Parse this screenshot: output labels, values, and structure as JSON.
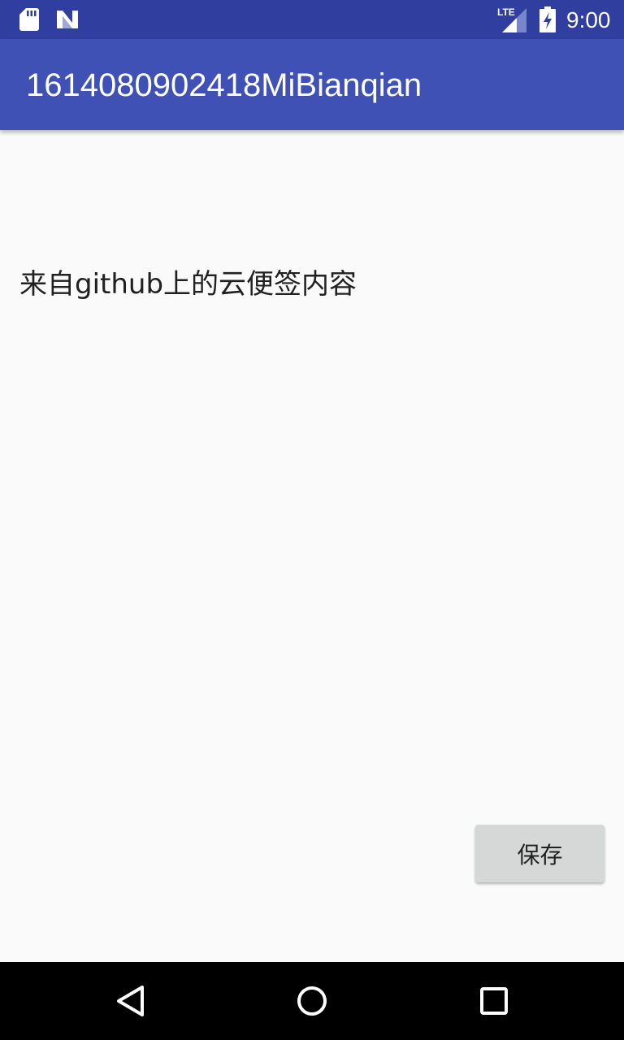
{
  "status_bar": {
    "network_label": "LTE",
    "time": "9:00",
    "icons": [
      "sd-card-icon",
      "notification-n-icon",
      "lte-signal-icon",
      "battery-charging-icon"
    ],
    "background_color": "#303f9f"
  },
  "app_bar": {
    "title": "1614080902418MiBianqian",
    "background_color": "#3f51b5"
  },
  "main": {
    "note_text": "来自github上的云便签内容"
  },
  "actions": {
    "save_label": "保存"
  },
  "navigation_bar": {
    "icons": [
      "back-icon",
      "home-icon",
      "recents-icon"
    ]
  }
}
